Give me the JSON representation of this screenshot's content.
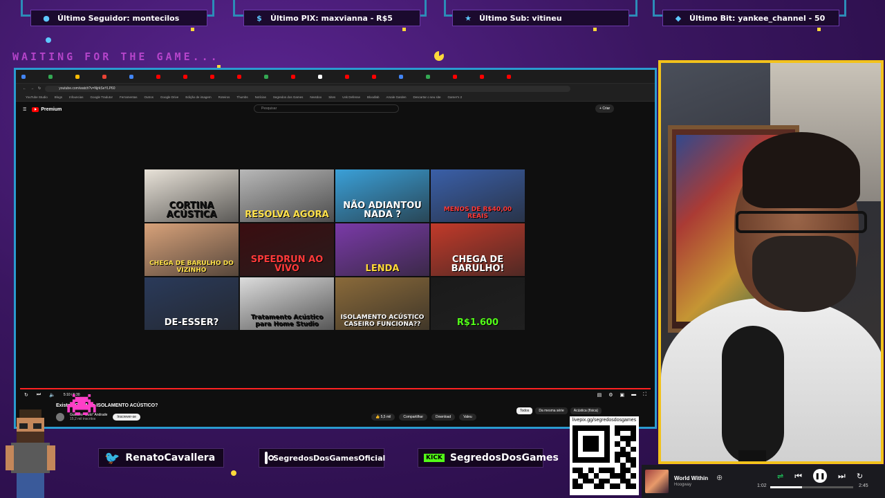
{
  "alerts": [
    {
      "icon": "person-icon",
      "label": "Último Seguidor: montecilos"
    },
    {
      "icon": "dollar-icon",
      "label": "Último PIX: maxvianna - R$5"
    },
    {
      "icon": "star-icon",
      "label": "Último Sub: vitineu"
    },
    {
      "icon": "diamond-icon",
      "label": "Último Bit: yankee_channel - 50"
    }
  ],
  "waiting_text": "WAITING FOR THE GAME...",
  "browser": {
    "url": "youtube.com/watch?v=NjrkSeYLP60",
    "search_placeholder": "Pesquisar",
    "logo_text": "Premium",
    "create_label": "Criar",
    "bookmarks": [
      "YouTube Studio",
      "Blogs",
      "Infouncias",
      "Google Tradutor",
      "Ferramentas",
      "Outros",
      "Google Drive",
      "Edição de imagem",
      "Roteiros",
      "Thumbs",
      "Notícias",
      "Segredos dos Games",
      "Nextdoo",
      "Sites",
      "Usk Defense",
      "Bloodlab",
      "Arsale Garden",
      "Descartar o seu site",
      "Gamer's 2"
    ]
  },
  "thumbnails": [
    {
      "text": "CORTINA ACÚSTICA",
      "bg": "#e8e2d8",
      "fg": "#111111"
    },
    {
      "text": "RESOLVA AGORA",
      "bg": "#b8b8b8",
      "fg": "#ffe14a"
    },
    {
      "text": "NÃO ADIANTOU NADA ?",
      "bg": "#3aa0d8",
      "fg": "#ffffff"
    },
    {
      "text": "MENOS DE R$40,00 REAIS",
      "bg": "#3a5fa8",
      "fg": "#ff3a3a"
    },
    {
      "text": "CHEGA DE BARULHO DO VIZINHO",
      "bg": "#d8a27a",
      "fg": "#ffe14a"
    },
    {
      "text": "SPEEDRUN AO VIVO",
      "bg": "#3a0d10",
      "fg": "#ff3a3a"
    },
    {
      "text": "LENDA",
      "bg": "#7a3aa8",
      "fg": "#ffd83a"
    },
    {
      "text": "CHEGA DE BARULHO!",
      "bg": "#c23a2a",
      "fg": "#ffffff"
    },
    {
      "text": "DE-ESSER?",
      "bg": "#2a3a5a",
      "fg": "#ffffff"
    },
    {
      "text": "Tratamento Acústico para Home Studio",
      "bg": "#dcdcdc",
      "fg": "#111111"
    },
    {
      "text": "ISOLAMENTO ACÚSTICO CASEIRO FUNCIONA??",
      "bg": "#8a6a3a",
      "fg": "#ffffff"
    },
    {
      "text": "R$1.600",
      "bg": "#1a1a1a",
      "fg": "#53fc18"
    }
  ],
  "video": {
    "time": "5:10 / 5:30",
    "title": "Existe PORTA de ISOLAMENTO ACÚSTICO?",
    "channel": "Gustavo \"Guto\" Andrade",
    "subscribers": "15,2 mil inscritos",
    "subscribe_label": "Inscrever-se",
    "likes": "5,5 mil",
    "share_label": "Compartilhar",
    "download_label": "Download",
    "thanks_label": "Valeu",
    "chips": [
      "Todos",
      "Da mesma série",
      "Acústica (física)"
    ]
  },
  "socials": {
    "twitter": "RenatoCavallera",
    "instagram": "SegredosDosGamesOficial",
    "kick_badge": "KICK",
    "kick": "SegredosDosGames"
  },
  "qr": {
    "url": "livepix.gg/segredosdosgames"
  },
  "music": {
    "title": "World Within",
    "artist": "Hoogway",
    "elapsed": "1:02",
    "duration": "2:45",
    "progress": 0.38
  },
  "colors": {
    "frame_blue": "#2a9bd0",
    "cam_yellow": "#f2c21b",
    "bg_purple": "#3a1660",
    "accent_magenta": "#c74bd8"
  }
}
